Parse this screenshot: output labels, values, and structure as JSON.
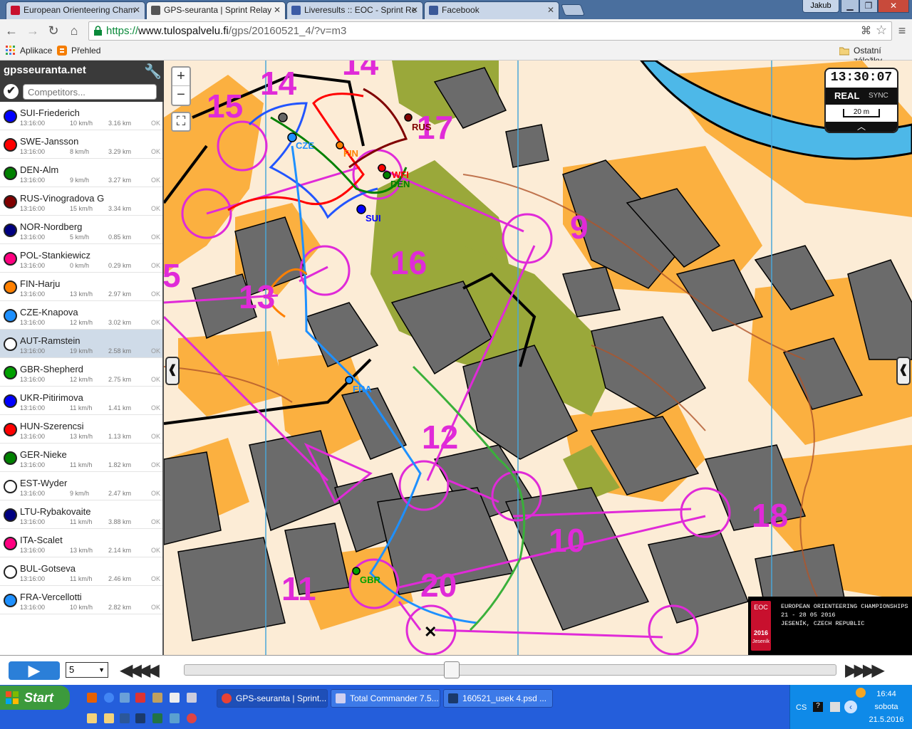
{
  "browser": {
    "tabs": [
      {
        "label": "European Orienteering Cham",
        "favicon_color": "#c8102e",
        "active": false
      },
      {
        "label": "GPS-seuranta | Sprint Relay",
        "favicon_color": "#555555",
        "active": true
      },
      {
        "label": "Liveresults :: EOC - Sprint Re",
        "favicon_color": "#3b5ba5",
        "active": false
      },
      {
        "label": "Facebook",
        "favicon_color": "#3b5998",
        "active": false
      }
    ],
    "user": "Jakub",
    "url_scheme": "https://",
    "url_host": "www.tulospalvelu.fi",
    "url_path": "/gps/20160521_4/?v=m3",
    "bookmarks": [
      {
        "label": "Aplikace",
        "icon": "apps-grid-icon"
      },
      {
        "label": "Přehled",
        "icon": "blogger-icon"
      }
    ],
    "other_bookmarks": "Ostatní záložky"
  },
  "sidebar": {
    "brand": "gpsseuranta.net",
    "search_placeholder": "Competitors...",
    "competitors": [
      {
        "name": "SUI-Friederich",
        "time": "13:16:00",
        "speed": "10 km/h",
        "dist": "3.16 km",
        "status": "OK",
        "color": "#0000ff"
      },
      {
        "name": "SWE-Jansson",
        "time": "13:16:00",
        "speed": "8 km/h",
        "dist": "3.29 km",
        "status": "OK",
        "color": "#ff0000"
      },
      {
        "name": "DEN-Alm",
        "time": "13:16:00",
        "speed": "9 km/h",
        "dist": "3.27 km",
        "status": "OK",
        "color": "#008000"
      },
      {
        "name": "RUS-Vinogradova G",
        "time": "13:16:00",
        "speed": "15 km/h",
        "dist": "3.34 km",
        "status": "OK",
        "color": "#800000"
      },
      {
        "name": "NOR-Nordberg",
        "time": "13:16:00",
        "speed": "5 km/h",
        "dist": "0.85 km",
        "status": "OK",
        "color": "#000080"
      },
      {
        "name": "POL-Stankiewicz",
        "time": "13:16:00",
        "speed": "0 km/h",
        "dist": "0.29 km",
        "status": "OK",
        "color": "#ff0080"
      },
      {
        "name": "FIN-Harju",
        "time": "13:16:00",
        "speed": "13 km/h",
        "dist": "2.97 km",
        "status": "OK",
        "color": "#ff8000"
      },
      {
        "name": "CZE-Knapova",
        "time": "13:16:00",
        "speed": "12 km/h",
        "dist": "3.02 km",
        "status": "OK",
        "color": "#1e90ff"
      },
      {
        "name": "AUT-Ramstein",
        "time": "13:16:00",
        "speed": "19 km/h",
        "dist": "2.58 km",
        "status": "OK",
        "color": "#ffffff"
      },
      {
        "name": "GBR-Shepherd",
        "time": "13:16:00",
        "speed": "12 km/h",
        "dist": "2.75 km",
        "status": "OK",
        "color": "#00a000"
      },
      {
        "name": "UKR-Pitirimova",
        "time": "13:16:00",
        "speed": "11 km/h",
        "dist": "1.41 km",
        "status": "OK",
        "color": "#0000ff"
      },
      {
        "name": "HUN-Szerencsi",
        "time": "13:16:00",
        "speed": "13 km/h",
        "dist": "1.13 km",
        "status": "OK",
        "color": "#ff0000"
      },
      {
        "name": "GER-Nieke",
        "time": "13:16:00",
        "speed": "11 km/h",
        "dist": "1.82 km",
        "status": "OK",
        "color": "#008000"
      },
      {
        "name": "EST-Wyder",
        "time": "13:16:00",
        "speed": "9 km/h",
        "dist": "2.47 km",
        "status": "OK",
        "color": "#ffffff"
      },
      {
        "name": "LTU-Rybakovaite",
        "time": "13:16:00",
        "speed": "11 km/h",
        "dist": "3.88 km",
        "status": "OK",
        "color": "#000080"
      },
      {
        "name": "ITA-Scalet",
        "time": "13:16:00",
        "speed": "13 km/h",
        "dist": "2.14 km",
        "status": "OK",
        "color": "#ff0080"
      },
      {
        "name": "BUL-Gotseva",
        "time": "13:16:00",
        "speed": "11 km/h",
        "dist": "2.46 km",
        "status": "OK",
        "color": "#ffffff"
      },
      {
        "name": "FRA-Vercellotti",
        "time": "13:16:00",
        "speed": "10 km/h",
        "dist": "2.82 km",
        "status": "OK",
        "color": "#1e90ff"
      }
    ]
  },
  "map": {
    "zoom_in": "+",
    "zoom_out": "−",
    "clock_time": "13:30:07",
    "clock_mode": "REAL",
    "clock_sync": "SYNC",
    "scale": "20 m",
    "controls": [
      "14",
      "15",
      "14",
      "17",
      "9",
      "16",
      "13",
      "5",
      "12",
      "10",
      "18",
      "11",
      "20"
    ],
    "runner_labels": [
      "RUS",
      "CZE",
      "FIN",
      "WFI",
      "DEN",
      "SUI",
      "FRA",
      "GBR"
    ],
    "eoc_logo": [
      "EOC",
      "2016",
      "Jeseník"
    ],
    "eoc_lines": [
      "EUROPEAN ORIENTEERING CHAMPIONSHIPS",
      "21 - 28 05 2016",
      "JESENÍK, CZECH REPUBLIC"
    ]
  },
  "player": {
    "speed_value": "5",
    "progress_fraction": 0.41
  },
  "taskbar": {
    "start_label": "Start",
    "tasks": [
      {
        "label": "GPS-seuranta | Sprint...",
        "icon_color": "#e94235"
      },
      {
        "label": "Total Commander 7.5...",
        "icon_color": "#d0d0f0"
      },
      {
        "label": "160521_usek 4.psd ...",
        "icon_color": "#1b3a6b"
      }
    ],
    "lang": "CS",
    "time": "16:44",
    "day": "sobota",
    "date": "21.5.2016"
  }
}
